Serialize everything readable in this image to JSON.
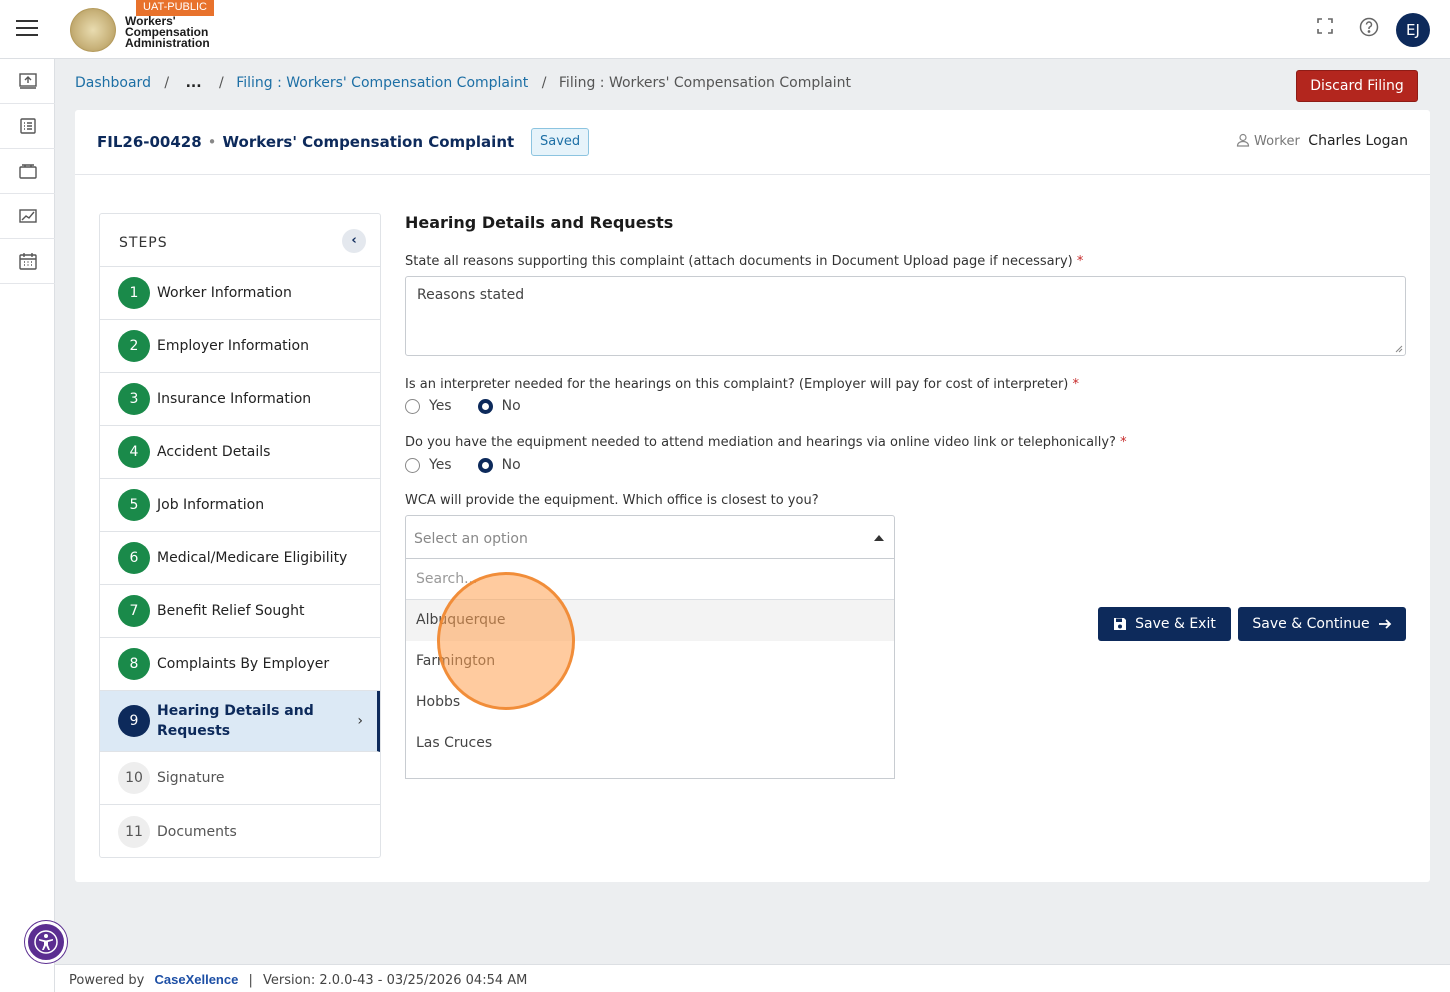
{
  "header": {
    "env_badge": "UAT-PUBLIC",
    "logo_lines": [
      "Workers'",
      "Compensation",
      "Administration"
    ],
    "avatar_initials": "EJ"
  },
  "breadcrumb": {
    "items": [
      "Dashboard",
      "...",
      "Filing : Workers' Compensation Complaint",
      "Filing : Workers' Compensation Complaint"
    ]
  },
  "actions": {
    "discard_label": "Discard Filing",
    "save_exit_label": "Save & Exit",
    "save_continue_label": "Save & Continue"
  },
  "filing": {
    "id": "FIL26-00428",
    "title": "Workers' Compensation Complaint",
    "status": "Saved",
    "worker_label": "Worker",
    "worker_name": "Charles Logan"
  },
  "steps": {
    "title": "STEPS",
    "items": [
      {
        "num": "1",
        "label": "Worker Information"
      },
      {
        "num": "2",
        "label": "Employer Information"
      },
      {
        "num": "3",
        "label": "Insurance Information"
      },
      {
        "num": "4",
        "label": "Accident Details"
      },
      {
        "num": "5",
        "label": "Job Information"
      },
      {
        "num": "6",
        "label": "Medical/Medicare Eligibility"
      },
      {
        "num": "7",
        "label": "Benefit Relief Sought"
      },
      {
        "num": "8",
        "label": "Complaints By Employer"
      },
      {
        "num": "9",
        "label": "Hearing Details and Requests"
      },
      {
        "num": "10",
        "label": "Signature"
      },
      {
        "num": "11",
        "label": "Documents"
      }
    ]
  },
  "form": {
    "section_title": "Hearing Details and Requests",
    "reasons": {
      "label": "State all reasons supporting this complaint (attach documents in Document Upload page if necessary)",
      "required_mark": "*",
      "value": "Reasons stated"
    },
    "interpreter": {
      "label": "Is an interpreter needed for the hearings on this complaint? (Employer will pay for cost of interpreter)",
      "required_mark": "*",
      "yes_label": "Yes",
      "no_label": "No",
      "selected": "No"
    },
    "equipment": {
      "label": "Do you have the equipment needed to attend mediation and hearings via online video link or telephonically?",
      "required_mark": "*",
      "yes_label": "Yes",
      "no_label": "No",
      "selected": "No"
    },
    "office": {
      "label": "WCA will provide the equipment. Which office is closest to you?",
      "placeholder": "Select an option",
      "search_placeholder": "Search...",
      "options": [
        "Albuquerque",
        "Farmington",
        "Hobbs",
        "Las Cruces"
      ]
    }
  },
  "footer": {
    "powered_by": "Powered by",
    "brand": "CaseXellence",
    "separator": "|",
    "version": "Version: 2.0.0-43 - 03/25/2026 04:54 AM"
  },
  "colors": {
    "primary": "#0d2a5b",
    "danger": "#b3261e",
    "complete": "#1a8a4a",
    "badge": "#e8722c"
  }
}
